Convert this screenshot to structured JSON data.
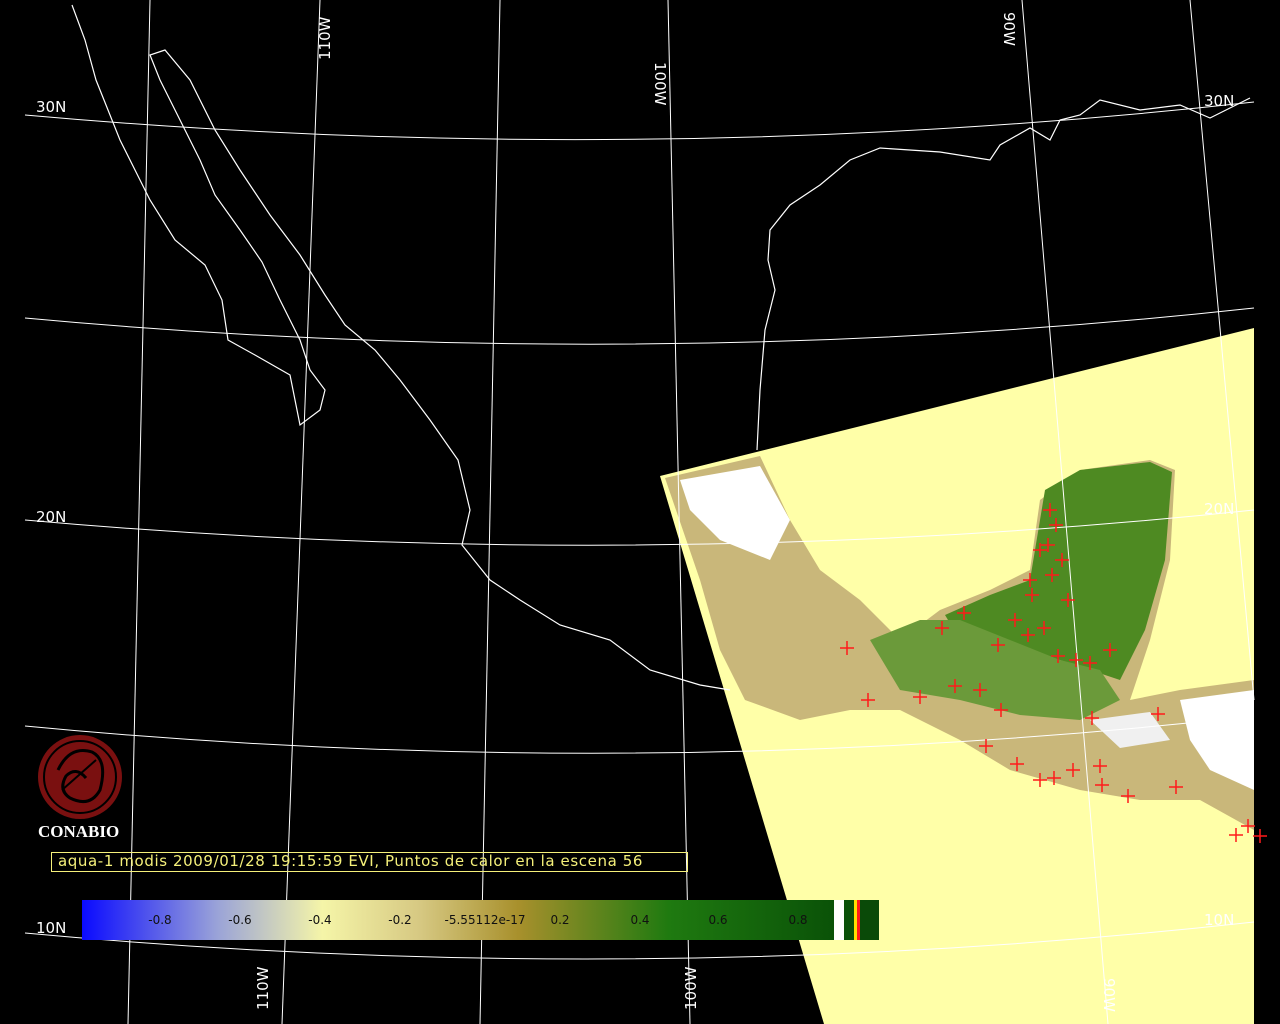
{
  "map": {
    "lon_labels_top": [
      "110W",
      "100W",
      "90W"
    ],
    "lon_labels_bottom": [
      "110W",
      "100W",
      "90W"
    ],
    "lat_labels_left": [
      "30N",
      "20N",
      "10N"
    ],
    "lat_labels_right": [
      "30N",
      "20N",
      "10N"
    ]
  },
  "title": "aqua-1 modis 2009/01/28 19:15:59 EVI, Puntos de calor en la escena 56",
  "logo": {
    "name": "CONABIO",
    "icon": "conabio-seal-icon",
    "color": "#8b1a1a"
  },
  "colorbar": {
    "ticks": [
      "-0.8",
      "-0.6",
      "-0.4",
      "-0.2",
      "-5.55112e-17",
      "0.2",
      "0.4",
      "0.6",
      "0.8"
    ],
    "colors": [
      "#0a0aff",
      "#9aa3d8",
      "#f5f5a8",
      "#d6c882",
      "#a8902c",
      "#1f7a10",
      "#0a5208"
    ]
  },
  "colors": {
    "water_no_data": "#ffffa8",
    "coast": "#ffffff",
    "hotspot": "#ff1a1a",
    "title": "#f5f07a"
  }
}
